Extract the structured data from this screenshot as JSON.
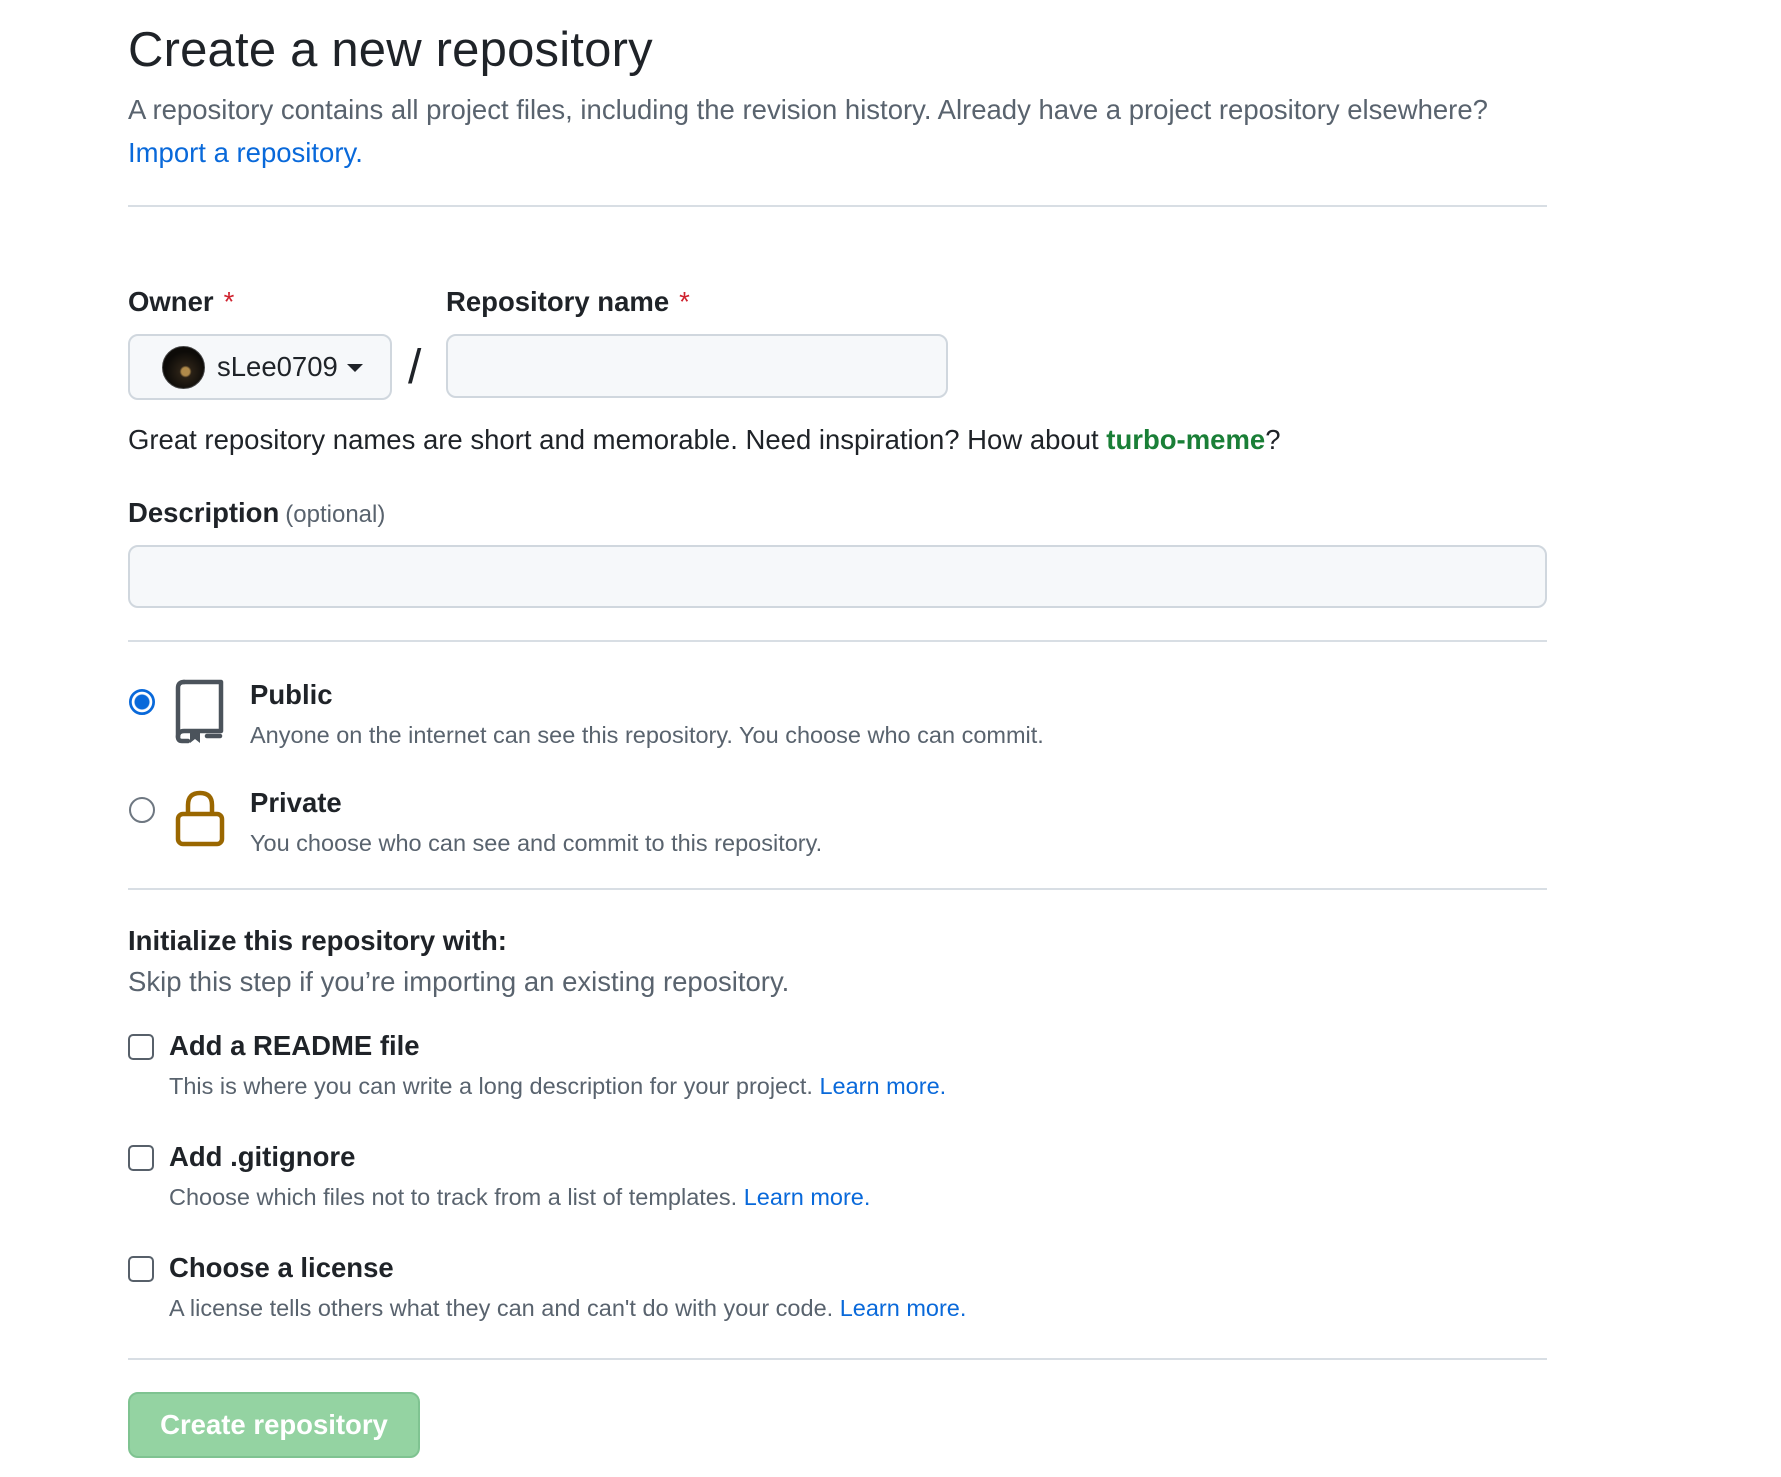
{
  "header": {
    "title": "Create a new repository",
    "subtitle": "A repository contains all project files, including the revision history. Already have a project repository elsewhere?",
    "import_link": "Import a repository."
  },
  "owner": {
    "label": "Owner",
    "required_mark": "*",
    "selected": "sLee0709"
  },
  "separator": "/",
  "repo_name": {
    "label": "Repository name",
    "required_mark": "*",
    "value": ""
  },
  "name_hint": {
    "text": "Great repository names are short and memorable. Need inspiration? How about ",
    "suggestion": "turbo-meme",
    "end": "?"
  },
  "description": {
    "label": "Description",
    "optional": "(optional)",
    "value": ""
  },
  "visibility": {
    "selected": "Public",
    "options": [
      {
        "title": "Public",
        "desc": "Anyone on the internet can see this repository. You choose who can commit.",
        "icon": "repo-icon"
      },
      {
        "title": "Private",
        "desc": "You choose who can see and commit to this repository.",
        "icon": "lock-icon"
      }
    ]
  },
  "init": {
    "title": "Initialize this repository with:",
    "subtitle": "Skip this step if you’re importing an existing repository.",
    "options": [
      {
        "title": "Add a README file",
        "desc": "This is where you can write a long description for your project. ",
        "link": "Learn more.",
        "checked": false
      },
      {
        "title": "Add .gitignore",
        "desc": "Choose which files not to track from a list of templates. ",
        "link": "Learn more.",
        "checked": false
      },
      {
        "title": "Choose a license",
        "desc": "A license tells others what they can and can't do with your code. ",
        "link": "Learn more.",
        "checked": false
      }
    ]
  },
  "submit": {
    "label": "Create repository",
    "disabled": true
  },
  "colors": {
    "link": "#0969da",
    "required": "#cf222e",
    "suggestion": "#1a7f37",
    "lock_icon": "#9a6700",
    "submit_disabled": "#94d3a2"
  }
}
